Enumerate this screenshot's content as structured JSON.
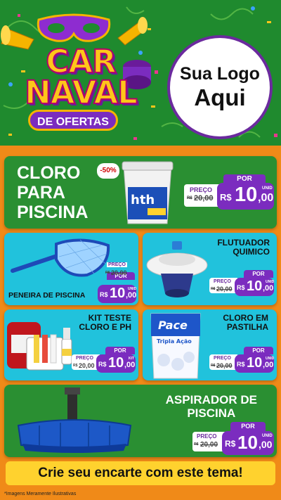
{
  "header": {
    "carnaval_line1": "CAR",
    "carnaval_line2": "NAVAL",
    "ofertas": "DE OFERTAS",
    "logo_line1": "Sua Logo",
    "logo_line2": "Aqui"
  },
  "colors": {
    "green": "#2a8f32",
    "cyan": "#21c2dc",
    "purple": "#7b2cbf",
    "orange": "#f08a18",
    "yellow": "#ffd22e"
  },
  "products": {
    "cloro": {
      "title_l1": "CLORO",
      "title_l2": "PARA",
      "title_l3": "PISCINA",
      "discount": "-50%",
      "brand": "hth",
      "por": "POR",
      "preco": "PREÇO",
      "old_prefix": "R$",
      "old": "20,00",
      "rs": "R$",
      "price_int": "10",
      "price_dec": ",00",
      "unit": "UNID"
    },
    "peneira": {
      "title": "PENEIRA DE PISCINA",
      "por": "POR",
      "preco": "PREÇO",
      "old_prefix": "R$",
      "old": "20,00",
      "rs": "R$",
      "price_int": "10",
      "price_dec": ",00",
      "unit": "UNID"
    },
    "flutuador": {
      "title_l1": "FLUTUADOR",
      "title_l2": "QUIMICO",
      "por": "POR",
      "preco": "PREÇO",
      "old_prefix": "R$",
      "old": "20,00",
      "rs": "R$",
      "price_int": "10",
      "price_dec": ",00",
      "unit": "UNID"
    },
    "kit": {
      "title_l1": "KIT TESTE",
      "title_l2": "CLORO E PH",
      "por": "POR",
      "preco": "PREÇO",
      "old_prefix": "R$",
      "old": "20,00",
      "rs": "R$",
      "price_int": "10",
      "price_dec": ",00",
      "unit": "KIT"
    },
    "pastilha": {
      "title_l1": "CLORO EM",
      "title_l2": "PASTILHA",
      "brand": "Pace",
      "sub": "Tripla Ação",
      "por": "POR",
      "preco": "PREÇO",
      "old_prefix": "R$",
      "old": "20,00",
      "rs": "R$",
      "price_int": "10",
      "price_dec": ",00",
      "unit": "UNID"
    },
    "aspirador": {
      "title_l1": "ASPIRADOR DE",
      "title_l2": "PISCINA",
      "por": "POR",
      "preco": "PREÇO",
      "old_prefix": "R$",
      "old": "20,00",
      "rs": "R$",
      "price_int": "10",
      "price_dec": ",00",
      "unit": "UNID"
    }
  },
  "footer": {
    "cta": "Crie seu encarte com este tema!",
    "disclaimer": "*Imagens Meramente Ilustrativas"
  }
}
